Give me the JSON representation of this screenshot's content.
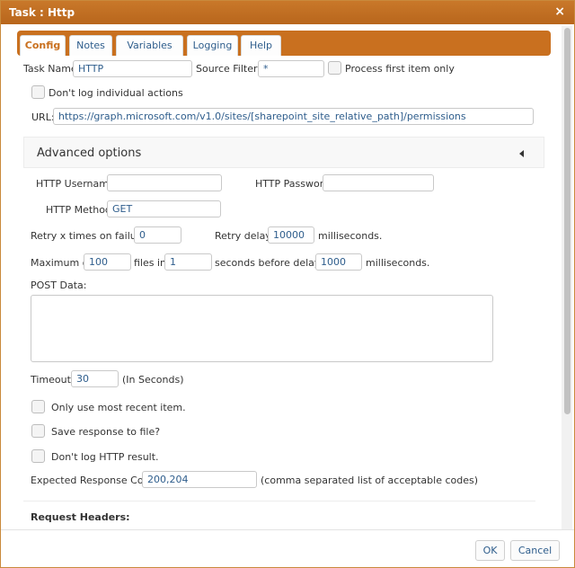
{
  "dialog": {
    "title": "Task : Http",
    "close_icon": "×"
  },
  "tabs": [
    "Config",
    "Notes",
    "Variables",
    "Logging",
    "Help"
  ],
  "config": {
    "task_name_label": "Task Name:",
    "task_name_value": "HTTP",
    "source_filter_label": "Source Filter :",
    "source_filter_value": "*",
    "process_first_label": "Process first item only",
    "dont_log_actions_label": "Don't log individual actions",
    "url_label": "URL:",
    "url_value": "https://graph.microsoft.com/v1.0/sites/[sharepoint_site_relative_path]/permissions"
  },
  "advanced": {
    "title": "Advanced options",
    "http_username_label": "HTTP Username:",
    "http_username_value": "",
    "http_password_label": "HTTP Password:",
    "http_password_value": "",
    "http_method_label": "HTTP Method:",
    "http_method_value": "GET",
    "retry_label": "Retry x times on failure:",
    "retry_value": "0",
    "retry_delay_label": "Retry delay:",
    "retry_delay_value": "10000",
    "retry_delay_unit": "milliseconds.",
    "max_of_label": "Maximum of",
    "max_files_value": "100",
    "files_in_label": "files in",
    "seconds_value": "1",
    "seconds_before_label": "seconds before delay of",
    "delay_value": "1000",
    "delay_unit": "milliseconds.",
    "post_data_label": "POST Data:",
    "timeout_label": "Timeout:",
    "timeout_value": "30",
    "timeout_unit": "(In Seconds)",
    "only_recent_label": "Only use most recent item.",
    "save_response_label": "Save response to file?",
    "dont_log_http_label": "Don't log HTTP result.",
    "expected_codes_label": "Expected Response Codes:",
    "expected_codes_value": "200,204",
    "expected_codes_hint": "(comma separated list of acceptable codes)",
    "request_headers_label": "Request Headers:"
  },
  "footer": {
    "ok_label": "OK",
    "cancel_label": "Cancel"
  }
}
